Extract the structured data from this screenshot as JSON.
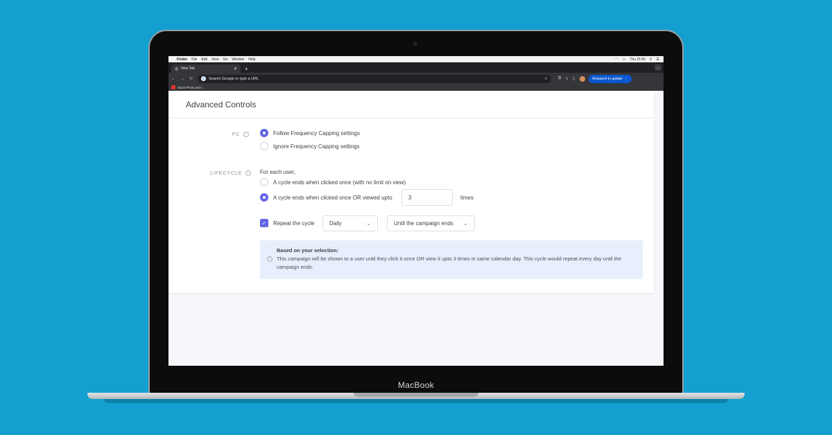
{
  "laptop": {
    "brand": "MacBook"
  },
  "mac_menubar": {
    "items": [
      "Finder",
      "File",
      "Edit",
      "View",
      "Go",
      "Window",
      "Help"
    ],
    "clock": "Thu 21:56"
  },
  "browser": {
    "tab_title": "New Tab",
    "omnibox_placeholder": "Search Google or type a URL",
    "relaunch_label": "Relaunch to update",
    "bookmark_label": "Stock Photo and I..."
  },
  "panel": {
    "title": "Advanced Controls",
    "fc": {
      "label": "FC",
      "options": [
        "Follow Frequency Capping settings",
        "Ignore Frequency Capping settings"
      ],
      "selected_index": 0
    },
    "lifecycle": {
      "label": "LIFECYCLE",
      "intro": "For each user,",
      "option_1": "A cycle ends when clicked once (with no limit on view)",
      "option_2": "A cycle ends when clicked once OR viewed upto",
      "views_value": "3",
      "views_suffix": "times",
      "selected_index": 1
    },
    "repeat": {
      "label": "Repeat the cycle",
      "checked": true,
      "frequency": "Daily",
      "until": "Until the campaign ends"
    },
    "summary": {
      "heading": "Based on your selection:",
      "text": "This campaign will be shown to a user until they click it once OR view it upto 3 times in same calendar day. This cycle would repeat every day until the campaign ends."
    }
  },
  "colors": {
    "background": "#139fcf",
    "accent": "#6366e5",
    "info_box": "#e8eefb"
  }
}
